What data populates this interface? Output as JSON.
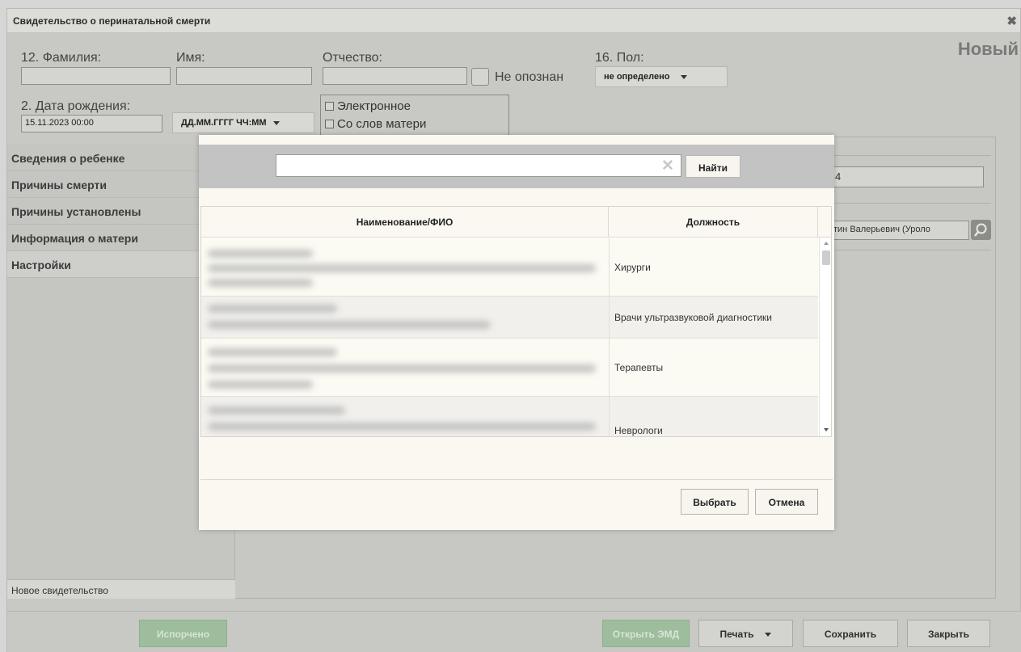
{
  "window": {
    "title": "Свидетельство о перинатальной смерти",
    "status": "Новый"
  },
  "form": {
    "surname_label": "12. Фамилия:",
    "surname_value": "",
    "name_label": "Имя:",
    "name_value": "",
    "patronymic_label": "Отчество:",
    "patronymic_value": "",
    "unidentified_label": "Не опознан",
    "sex_label": "16. Пол:",
    "sex_value": "не определено",
    "birthdate_label": "2. Дата рождения:",
    "birthdate_value": "15.11.2023 00:00",
    "date_format": "ДД.ММ.ГГГГ ЧЧ:ММ",
    "electronic_label": "Электронное",
    "mother_words_label": "Со слов матери"
  },
  "sidebar": {
    "items": [
      {
        "label": "Сведения о ребенке"
      },
      {
        "label": "Причины смерти"
      },
      {
        "label": "Причины установлены"
      },
      {
        "label": "Информация о матери"
      },
      {
        "label": "Настройки"
      }
    ],
    "bottom_tab": "Новое свидетельство"
  },
  "background": {
    "field_value": "4",
    "doctor_value": "тин Валерьевич (Уроло"
  },
  "footer": {
    "spoiled": "Испорчено",
    "open_emd": "Открыть ЭМД",
    "print": "Печать",
    "save": "Сохранить",
    "close": "Закрыть"
  },
  "modal": {
    "search_value": "",
    "find_button": "Найти",
    "columns": [
      "Наименование/ФИО",
      "Должность"
    ],
    "rows": [
      {
        "position": "Хирурги"
      },
      {
        "position": "Врачи ультразвуковой диагностики"
      },
      {
        "position": "Терапевты"
      },
      {
        "position": "Неврологи"
      }
    ],
    "select_button": "Выбрать",
    "cancel_button": "Отмена"
  }
}
